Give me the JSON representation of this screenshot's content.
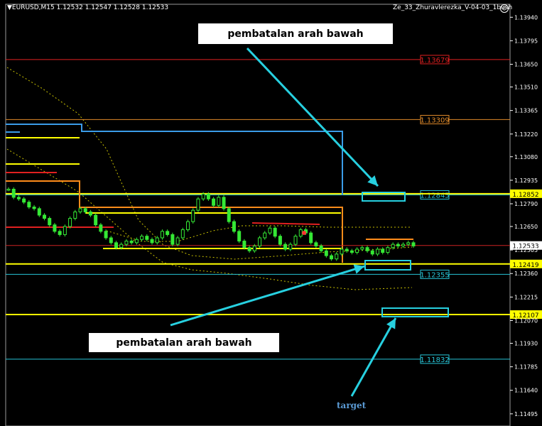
{
  "header": {
    "symbol_info": "▼EURUSD,M15  1.12532 1.12547 1.12528 1.12533",
    "indicator_name": "Ze_33_Zhuravlerezka_V-04-03_1bush"
  },
  "annotations": {
    "top_text": "pembatalan arah bawah",
    "bottom_text": "pembatalan arah bawah",
    "target_text": "target"
  },
  "chart_data": {
    "type": "candlestick",
    "symbol": "EURUSD",
    "timeframe": "M15",
    "ylim": [
      1.1142,
      1.1402
    ],
    "price_ticks": [
      1.1394,
      1.13795,
      1.1365,
      1.1351,
      1.13365,
      1.1322,
      1.1308,
      1.12935,
      1.1279,
      1.1265,
      1.12505,
      1.1236,
      1.12215,
      1.1207,
      1.1193,
      1.11785,
      1.1164,
      1.11495
    ],
    "price_tick_labels": [
      "1.13940",
      "1.13795",
      "1.13650",
      "1.13510",
      "1.13365",
      "1.13220",
      "1.13080",
      "1.12935",
      "1.12790",
      "1.12650",
      "1.12505",
      "1.12360",
      "1.12215",
      "1.12070",
      "1.11930",
      "1.11785",
      "1.11640",
      "1.11495"
    ],
    "current_price": 1.12533,
    "current_price_label": "1.12533",
    "levels": [
      {
        "price": 1.13679,
        "label": "1.13679",
        "color": "#e02020"
      },
      {
        "price": 1.13309,
        "label": "1.13309",
        "color": "#e08a2a"
      },
      {
        "price": 1.12845,
        "label": "1.12845",
        "color": "#27c4d6"
      },
      {
        "price": 1.12355,
        "label": "1.12355",
        "color": "#27c4d6"
      },
      {
        "price": 1.11832,
        "label": "1.11832",
        "color": "#27c4d6"
      }
    ],
    "axis_markers": [
      {
        "price": 1.12852,
        "label": "1.12852",
        "color": "#ffff00"
      },
      {
        "price": 1.12419,
        "label": "1.12419",
        "color": "#ffff00"
      },
      {
        "price": 1.12107,
        "label": "1.12107",
        "color": "#ffff00"
      }
    ],
    "close_series": [
      1.1288,
      1.1283,
      1.1282,
      1.128,
      1.1277,
      1.1276,
      1.1272,
      1.127,
      1.1266,
      1.1262,
      1.126,
      1.1265,
      1.127,
      1.1274,
      1.1276,
      1.1274,
      1.1272,
      1.1266,
      1.1262,
      1.1258,
      1.1255,
      1.1252,
      1.1254,
      1.1256,
      1.1255,
      1.1257,
      1.1259,
      1.1257,
      1.1255,
      1.1258,
      1.1262,
      1.126,
      1.1254,
      1.1258,
      1.1263,
      1.1268,
      1.1275,
      1.1282,
      1.1285,
      1.1282,
      1.1278,
      1.1283,
      1.1276,
      1.1268,
      1.1262,
      1.1256,
      1.1252,
      1.125,
      1.1253,
      1.1258,
      1.1261,
      1.1264,
      1.1259,
      1.1254,
      1.1251,
      1.1254,
      1.1259,
      1.1263,
      1.1261,
      1.1255,
      1.1253,
      1.125,
      1.1247,
      1.1245,
      1.1248,
      1.1251,
      1.125,
      1.1249,
      1.1251,
      1.1252,
      1.125,
      1.1248,
      1.1251,
      1.1249,
      1.1252,
      1.1254,
      1.1253,
      1.1254,
      1.1255,
      1.1253
    ]
  }
}
